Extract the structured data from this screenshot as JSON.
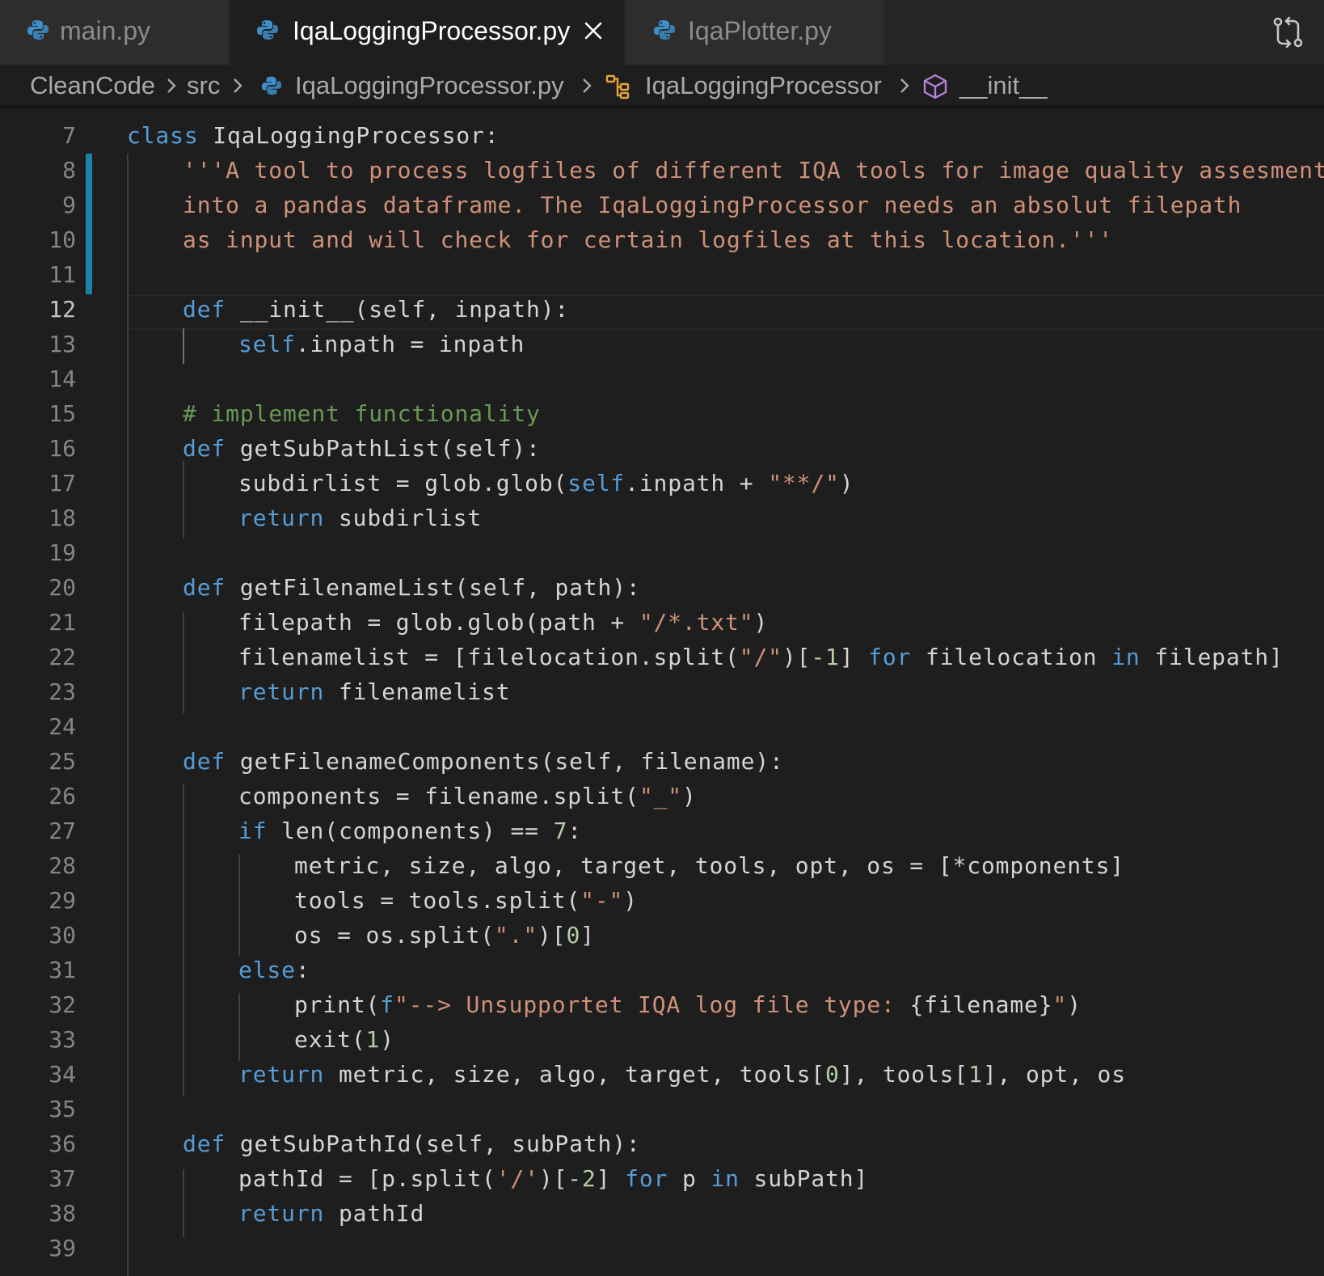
{
  "tabs": [
    {
      "label": "main.py",
      "active": false,
      "icon": "python-icon"
    },
    {
      "label": "IqaLoggingProcessor.py",
      "active": true,
      "icon": "python-icon"
    },
    {
      "label": "IqaPlotter.py",
      "active": false,
      "icon": "python-icon"
    }
  ],
  "breadcrumb": {
    "folder": "CleanCode",
    "subfolder": "src",
    "file": "IqaLoggingProcessor.py",
    "class_name": "IqaLoggingProcessor",
    "method": "__init__"
  },
  "colors": {
    "editor_bg": "#1e1e1e",
    "tab_inactive_bg": "#2d2d2d",
    "keyword": "#569cd6",
    "string": "#ce9178",
    "comment": "#6a9955",
    "number": "#b5cea8",
    "git_modified": "#1b81a8"
  },
  "editor": {
    "active_line": 12,
    "line_numbers": [
      "7",
      "8",
      "9",
      "10",
      "11",
      "12",
      "13",
      "14",
      "15",
      "16",
      "17",
      "18",
      "19",
      "20",
      "21",
      "22",
      "23",
      "24",
      "25",
      "26",
      "27",
      "28",
      "29",
      "30",
      "31",
      "32",
      "33",
      "34",
      "35",
      "36",
      "37",
      "38",
      "39"
    ],
    "code": {
      "l7_kw": "class",
      "l7_rest": " IqaLoggingProcessor:",
      "l8": "'''A tool to process logfiles of different IQA tools for image quality assesment",
      "l9": "into a pandas dataframe. The IqaLoggingProcessor needs an absolut filepath",
      "l10": "as input and will check for certain logfiles at this location.'''",
      "l12_kw": "def",
      "l12_rest": " __init__(self, inpath):",
      "l13_self": "self",
      "l13_rest": ".inpath = inpath",
      "l15": "# implement functionality",
      "l16_kw": "def",
      "l16_rest": " getSubPathList(self):",
      "l17_a": "subdirlist = glob.glob(",
      "l17_self": "self",
      "l17_b": ".inpath + ",
      "l17_str": "\"**/\"",
      "l17_c": ")",
      "l18_kw": "return",
      "l18_rest": " subdirlist",
      "l20_kw": "def",
      "l20_rest": " getFilenameList(self, path):",
      "l21_a": "filepath = glob.glob(path + ",
      "l21_str": "\"/*.txt\"",
      "l21_b": ")",
      "l22_a": "filenamelist = [filelocation.split(",
      "l22_str": "\"/\"",
      "l22_b": ")[",
      "l22_num": "-1",
      "l22_c": "] ",
      "l22_for": "for",
      "l22_d": " filelocation ",
      "l22_in": "in",
      "l22_e": " filepath]",
      "l23_kw": "return",
      "l23_rest": " filenamelist",
      "l25_kw": "def",
      "l25_rest": " getFilenameComponents(self, filename):",
      "l26_a": "components = filename.split(",
      "l26_str": "\"_\"",
      "l26_b": ")",
      "l27_kw": "if",
      "l27_a": " len(components) == ",
      "l27_num": "7",
      "l27_b": ":",
      "l28": "metric, size, algo, target, tools, opt, os = [*components]",
      "l29_a": "tools = tools.split(",
      "l29_str": "\"-\"",
      "l29_b": ")",
      "l30_a": "os = os.split(",
      "l30_str": "\".\"",
      "l30_b": ")[",
      "l30_num": "0",
      "l30_c": "]",
      "l31_kw": "else",
      "l31_rest": ":",
      "l32_a": "print(",
      "l32_f": "f",
      "l32_str": "\"--> Unsupportet IQA log file type: ",
      "l32_var": "{filename}",
      "l32_str2": "\"",
      "l32_b": ")",
      "l33_a": "exit(",
      "l33_num": "1",
      "l33_b": ")",
      "l34_kw": "return",
      "l34_a": " metric, size, algo, target, tools[",
      "l34_n0": "0",
      "l34_b": "], tools[",
      "l34_n1": "1",
      "l34_c": "], opt, os",
      "l36_kw": "def",
      "l36_rest": " getSubPathId(self, subPath):",
      "l37_a": "pathId = [p.split(",
      "l37_str": "'/'",
      "l37_b": ")[",
      "l37_num": "-2",
      "l37_c": "] ",
      "l37_for": "for",
      "l37_d": " p ",
      "l37_in": "in",
      "l37_e": " subPath]",
      "l38_kw": "return",
      "l38_rest": " pathId"
    }
  }
}
